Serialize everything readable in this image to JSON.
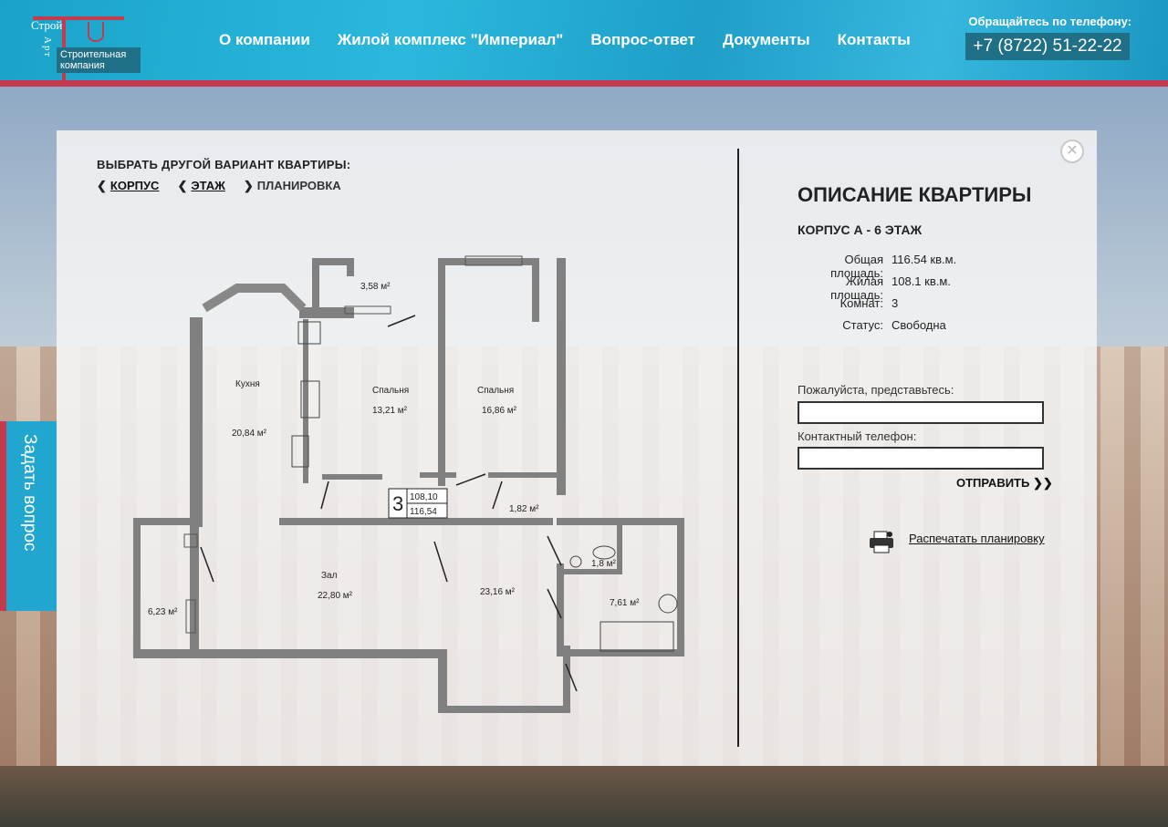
{
  "header": {
    "logo_word1": "Строй",
    "logo_word2": "Арт",
    "logo_subtitle": "Строительная компания",
    "nav": [
      {
        "label": "О компании"
      },
      {
        "label": "Жилой комплекс \"Империал\""
      },
      {
        "label": "Вопрос-ответ"
      },
      {
        "label": "Документы"
      },
      {
        "label": "Контакты"
      }
    ],
    "phone_label": "Обращайтесь по телефону:",
    "phone": "+7 (8722) 51-22-22"
  },
  "side_tab": {
    "label": "Задать вопрос"
  },
  "panel": {
    "close_icon": "✕",
    "choose_title": "ВЫБРАТЬ ДРУГОЙ ВАРИАНТ КВАРТИРЫ:",
    "breadcrumb": {
      "korpus": "КОРПУС",
      "etazh": "ЭТАЖ",
      "planirovka": "ПЛАНИРОВКА"
    },
    "plan": {
      "rooms": {
        "balcony": "3,58 м²",
        "kitchen": "Кухня",
        "kitchen_area": "20,84 м²",
        "bedroom1": "Спальня",
        "bedroom1_area": "13,21 м²",
        "bedroom2": "Спальня",
        "bedroom2_area": "16,86 м²",
        "hall_area_small": "1,82 м²",
        "wc_area": "1,8 м²",
        "bath_area": "7,61 м²",
        "living": "Зал",
        "living_area": "22,80 м²",
        "corridor_area": "23,16 м²",
        "loggia_area": "6,23 м²"
      },
      "badge": {
        "rooms": "3",
        "living_area": "108,10",
        "total_area": "116,54"
      }
    },
    "description": {
      "title": "ОПИСАНИЕ КВАРТИРЫ",
      "subtitle": "КОРПУС А - 6 ЭТАЖ",
      "facts": [
        {
          "k": "Общая площадь:",
          "v": "116.54 кв.м."
        },
        {
          "k": "Жилая площадь:",
          "v": "108.1 кв.м."
        },
        {
          "k": "Комнат:",
          "v": "3"
        },
        {
          "k": "Статус:",
          "v": "Свободна"
        }
      ]
    },
    "form": {
      "name_label": "Пожалуйста, представьтесь:",
      "name_value": "",
      "phone_label": "Контактный телефон:",
      "phone_value": "",
      "submit": "ОТПРАВИТЬ"
    },
    "print_label": "Распечатать планировку"
  },
  "colors": {
    "header_blue": "#1ea6cd",
    "accent_red": "#c73a4e",
    "phone_bg": "#1f6f86",
    "wall_gray": "#7d7d7d"
  }
}
